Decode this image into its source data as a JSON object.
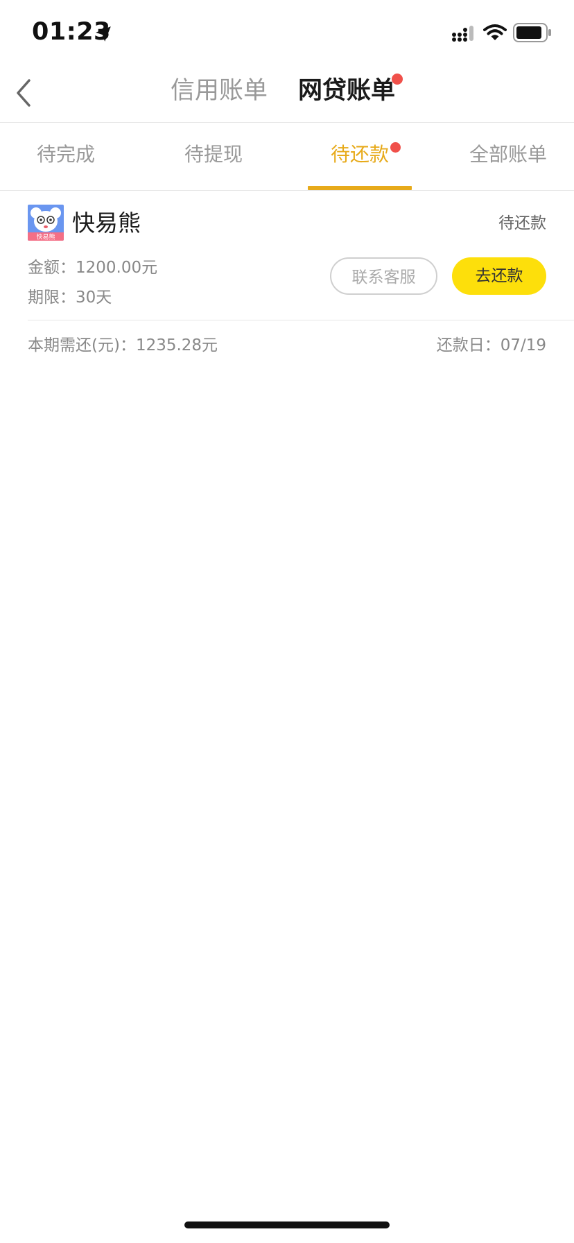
{
  "status_bar": {
    "time": "01:23",
    "icons": [
      "location-arrow-icon",
      "signal-icon",
      "wifi-icon",
      "battery-icon"
    ]
  },
  "nav": {
    "tabs": [
      {
        "label": "信用账单",
        "active": false
      },
      {
        "label": "网贷账单",
        "active": true,
        "badge": true
      }
    ]
  },
  "subtabs": {
    "items": [
      {
        "label": "待完成"
      },
      {
        "label": "待提现"
      },
      {
        "label": "待还款",
        "active": true,
        "badge": true
      },
      {
        "label": "全部账单"
      }
    ]
  },
  "bill": {
    "lender_logo_text": "快易熊",
    "lender_name": "快易熊",
    "status": "待还款",
    "amount": "金额：1200.00元",
    "term": "期限：30天",
    "contact_button": "联系客服",
    "pay_button": "去还款",
    "due_amount": "本期需还(元)：1235.28元",
    "due_date": "还款日：07/19"
  },
  "colors": {
    "accent": "#e7aa1a",
    "pay_button": "#fddf0b",
    "badge": "#f0504a",
    "muted_text": "#999999"
  }
}
